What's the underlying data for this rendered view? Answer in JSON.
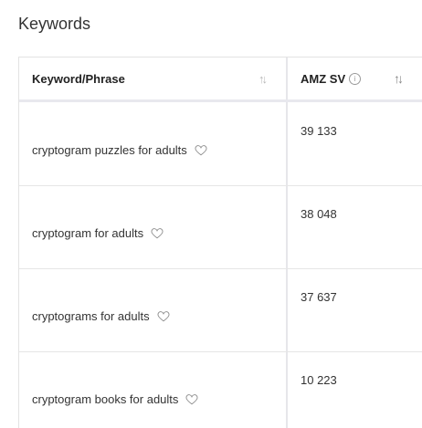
{
  "header": {
    "title": "Keywords"
  },
  "table": {
    "columns": [
      {
        "label": "Keyword/Phrase",
        "sort_icon": "sort-arrows-icon"
      },
      {
        "label": "AMZ SV",
        "info_icon": "info-icon",
        "sort_icon": "sort-arrows-icon"
      }
    ],
    "rows": [
      {
        "keyword": "cryptogram puzzles for adults",
        "amz_sv": "39 133"
      },
      {
        "keyword": "cryptogram for adults",
        "amz_sv": "38 048"
      },
      {
        "keyword": "cryptograms for adults",
        "amz_sv": "37 637"
      },
      {
        "keyword": "cryptogram books for adults",
        "amz_sv": "10 223"
      }
    ]
  },
  "colors": {
    "text": "#333333",
    "border": "#e6e6e6",
    "icon": "#9a9a9a"
  }
}
